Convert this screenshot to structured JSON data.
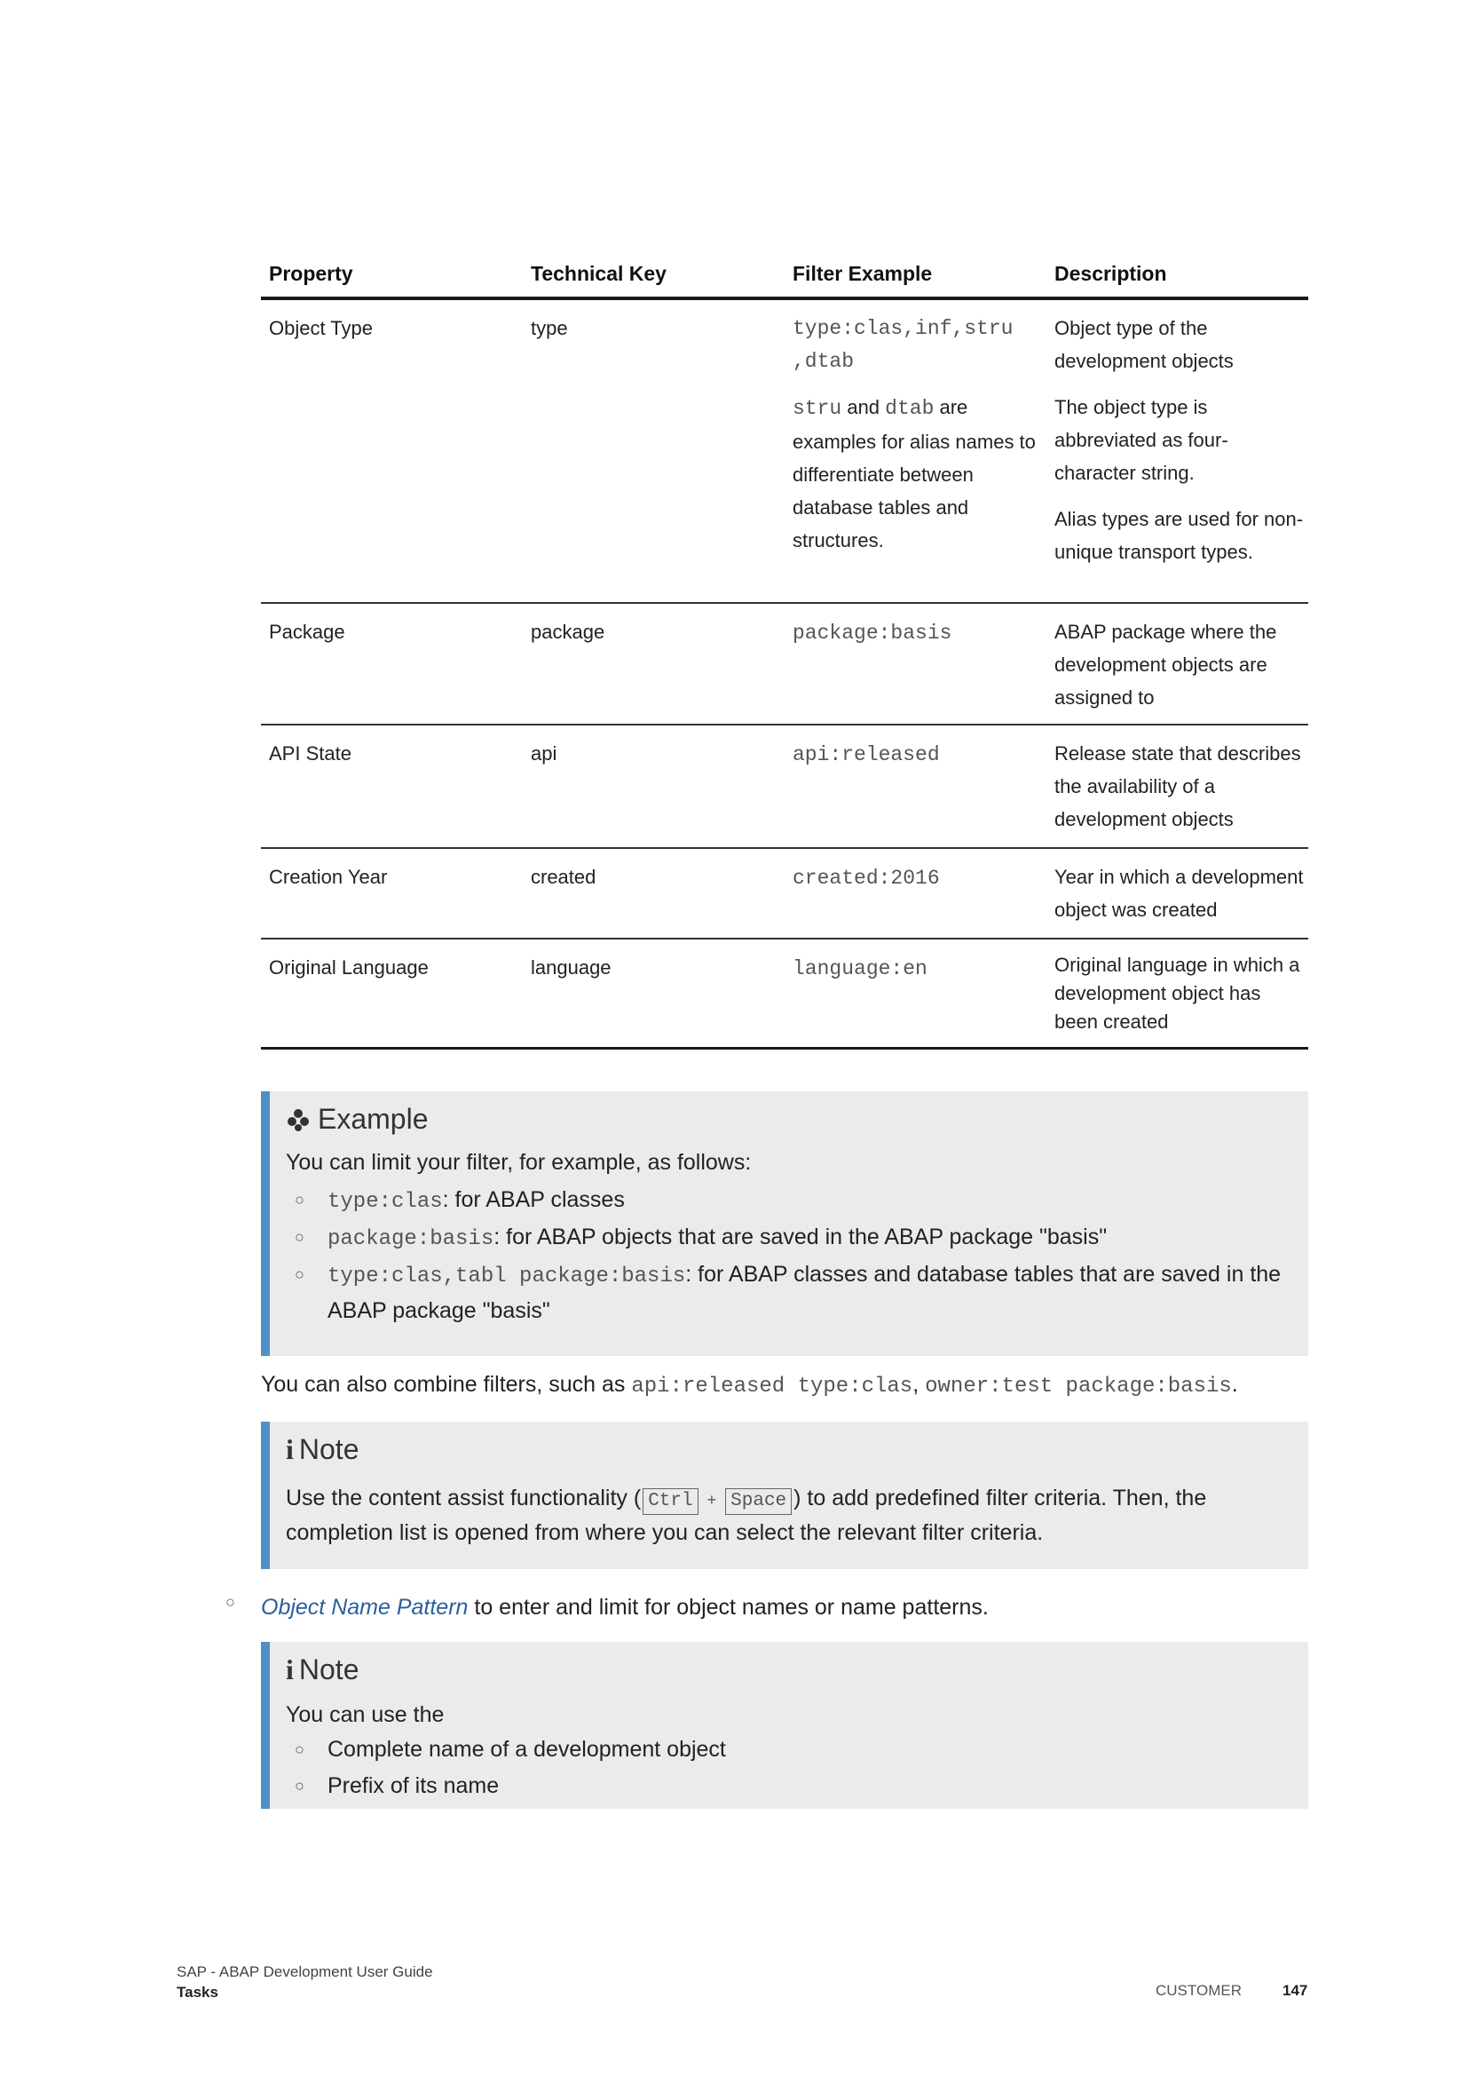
{
  "table": {
    "headers": [
      "Property",
      "Technical Key",
      "Filter Example",
      "Description"
    ],
    "rows": [
      {
        "property": "Object Type",
        "key": "type",
        "filter_code_1": "type:clas,inf,stru",
        "filter_code_2": ",dtab",
        "filter_note_code_a": "stru",
        "filter_note_and": " and ",
        "filter_note_code_b": "dtab",
        "filter_note_text": " are examples for alias names to differentiate between database tables and structures.",
        "desc_1": "Object type of the development objects",
        "desc_2": "The object type is abbreviated as four-character string.",
        "desc_3": "Alias types are used for non-unique transport types."
      },
      {
        "property": "Package",
        "key": "package",
        "filter": "package:basis",
        "desc": "ABAP package where the development objects are assigned to"
      },
      {
        "property": "API State",
        "key": "api",
        "filter": "api:released",
        "desc": "Release state that describes the availability of a development objects"
      },
      {
        "property": "Creation Year",
        "key": "created",
        "filter": "created:2016",
        "desc": "Year in which a development object was created"
      },
      {
        "property": "Original Language",
        "key": "language",
        "filter": "language:en",
        "desc": "Original language in which a development object has been created"
      }
    ]
  },
  "example_box": {
    "title": "Example",
    "intro": "You can limit your filter, for example, as follows:",
    "items": [
      {
        "code": "type:clas",
        "text": ": for ABAP classes"
      },
      {
        "code": "package:basis",
        "text": ": for ABAP objects that are saved in the ABAP package \"basis\""
      },
      {
        "code": "type:clas,tabl package:basis",
        "text": ": for ABAP classes and database tables that are saved in the ABAP package \"basis\""
      }
    ]
  },
  "combine": {
    "text": "You can also combine filters, such as ",
    "code_1": "api:released type:clas",
    "sep": ", ",
    "code_2": "owner:test package:basis",
    "end": "."
  },
  "note_1": {
    "title": "Note",
    "text_before": "Use the content assist functionality (",
    "key_1": "Ctrl",
    "plus": "+",
    "key_2": "Space",
    "text_after": ") to add predefined filter criteria. Then, the completion list is opened from where you can select the relevant filter criteria."
  },
  "name_pattern": {
    "link": "Object Name Pattern",
    "text": " to enter and limit for object names or name patterns."
  },
  "note_2": {
    "title": "Note",
    "intro": "You can use the",
    "items": [
      "Complete name of a development object",
      "Prefix of its name"
    ]
  },
  "footer": {
    "doc_title": "SAP - ABAP Development User Guide",
    "section": "Tasks",
    "classification": "CUSTOMER",
    "page_number": "147"
  }
}
